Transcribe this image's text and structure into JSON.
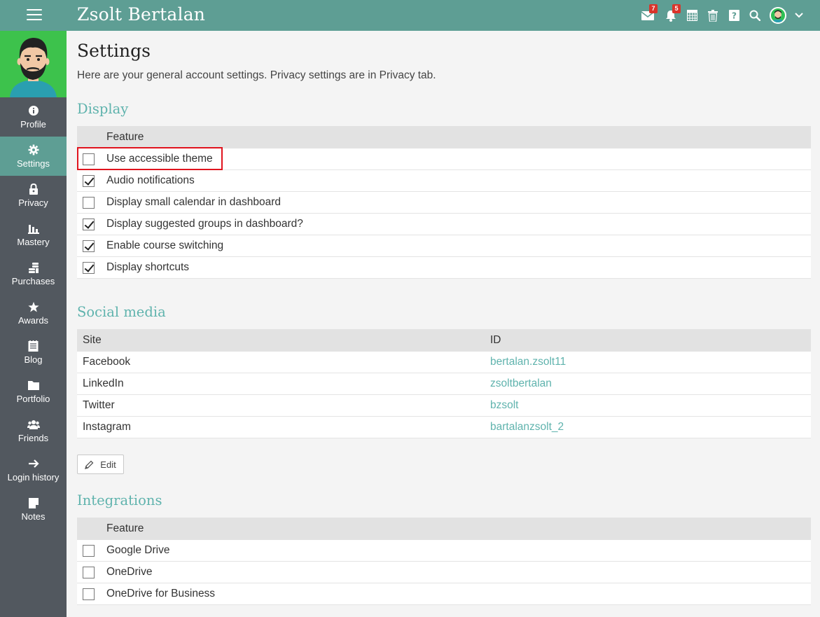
{
  "header": {
    "title": "Zsolt Bertalan",
    "messages_badge": "7",
    "notifications_badge": "5"
  },
  "sidebar": {
    "items": [
      {
        "label": "Profile",
        "icon": "info-icon",
        "active": false
      },
      {
        "label": "Settings",
        "icon": "gear-icon",
        "active": true
      },
      {
        "label": "Privacy",
        "icon": "lock-icon",
        "active": false
      },
      {
        "label": "Mastery",
        "icon": "bar-chart-icon",
        "active": false
      },
      {
        "label": "Purchases",
        "icon": "coins-icon",
        "active": false
      },
      {
        "label": "Awards",
        "icon": "star-icon",
        "active": false
      },
      {
        "label": "Blog",
        "icon": "blog-icon",
        "active": false
      },
      {
        "label": "Portfolio",
        "icon": "folder-icon",
        "active": false
      },
      {
        "label": "Friends",
        "icon": "friends-icon",
        "active": false
      },
      {
        "label": "Login history",
        "icon": "arrow-right-icon",
        "active": false
      },
      {
        "label": "Notes",
        "icon": "note-icon",
        "active": false
      }
    ]
  },
  "page": {
    "title": "Settings",
    "description": "Here are your general account settings. Privacy settings are in Privacy tab."
  },
  "display": {
    "title": "Display",
    "header": "Feature",
    "rows": [
      {
        "label": "Use accessible theme",
        "checked": false
      },
      {
        "label": "Audio notifications",
        "checked": true
      },
      {
        "label": "Display small calendar in dashboard",
        "checked": false
      },
      {
        "label": "Display suggested groups in dashboard?",
        "checked": true
      },
      {
        "label": "Enable course switching",
        "checked": true
      },
      {
        "label": "Display shortcuts",
        "checked": true
      }
    ]
  },
  "social": {
    "title": "Social media",
    "headers": [
      "Site",
      "ID"
    ],
    "rows": [
      {
        "site": "Facebook",
        "id": "bertalan.zsolt11"
      },
      {
        "site": "LinkedIn",
        "id": "zsoltbertalan"
      },
      {
        "site": "Twitter",
        "id": "bzsolt"
      },
      {
        "site": "Instagram",
        "id": "bartalanzsolt_2"
      }
    ],
    "edit_label": "Edit"
  },
  "integrations": {
    "title": "Integrations",
    "header": "Feature",
    "rows": [
      {
        "label": "Google Drive",
        "checked": false
      },
      {
        "label": "OneDrive",
        "checked": false
      },
      {
        "label": "OneDrive for Business",
        "checked": false
      }
    ]
  },
  "colors": {
    "topbar": "#5e9e94",
    "sidebar": "#52585f",
    "accent": "#5fb3ad",
    "highlight": "#e0141e",
    "badge": "#d9342b"
  }
}
